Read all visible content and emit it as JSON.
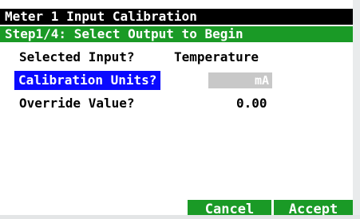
{
  "header": {
    "title": "Meter 1 Input Calibration",
    "step": "Step1/4: Select Output to Begin"
  },
  "fields": [
    {
      "label": "Selected Input?",
      "value": "Temperature"
    },
    {
      "label": "Calibration Units?",
      "value": "mA"
    },
    {
      "label": "Override Value?",
      "value": "0.00"
    }
  ],
  "buttons": {
    "cancel": "Cancel",
    "accept": "Accept"
  },
  "colors": {
    "title_bar": "#000000",
    "step_bar": "#1a9a26",
    "selection": "#0a0aff",
    "button": "#1a9a26",
    "units_field": "#c8c8c8"
  }
}
